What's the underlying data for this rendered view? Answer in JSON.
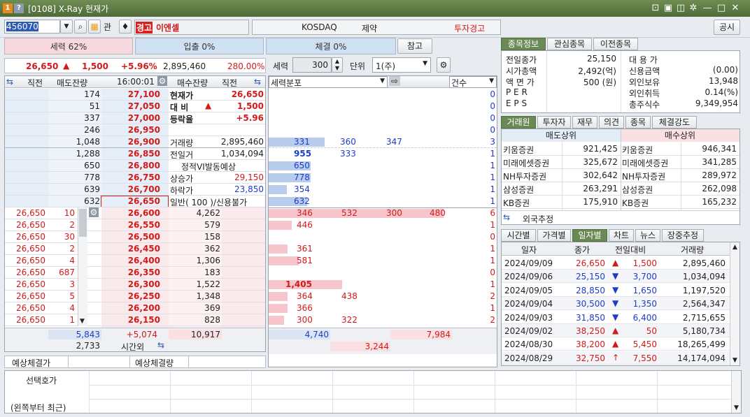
{
  "window": {
    "title": "[0108] X-Ray 현재가"
  },
  "toolbar": {
    "code": "456070",
    "stock_name": "이엔셀",
    "warn_badge": "경고",
    "market": "KOSDAQ",
    "sector": "제약",
    "warning": "투자경고",
    "notice_btn": "공시",
    "gwan": "관"
  },
  "row2": {
    "force": "세력 62%",
    "inout": "입출 0%",
    "fill": "체결 0%",
    "ref": "참고"
  },
  "price_row": {
    "price": "26,650",
    "arrow": "▲",
    "change": "1,500",
    "rate": "+5.96%",
    "volume": "2,895,460",
    "vol_rate": "280.00%",
    "force_label": "세력",
    "force_val": "300",
    "unit_label": "단위",
    "unit_val": "1(주)"
  },
  "ob_header": {
    "prev": "직전",
    "sell_qty": "매도잔량",
    "time": "16:00:01",
    "buy_qty": "매수잔량",
    "prev2": "직전"
  },
  "asks": [
    {
      "qty": "174",
      "price": "27,100"
    },
    {
      "qty": "51",
      "price": "27,050"
    },
    {
      "qty": "337",
      "price": "27,000"
    },
    {
      "qty": "246",
      "price": "26,950"
    },
    {
      "qty": "1,048",
      "price": "26,900"
    },
    {
      "qty": "1,288",
      "price": "26,850"
    },
    {
      "qty": "650",
      "price": "26,800"
    },
    {
      "qty": "778",
      "price": "26,750"
    },
    {
      "qty": "639",
      "price": "26,700"
    },
    {
      "qty": "632",
      "price": "26,650"
    }
  ],
  "bids": [
    {
      "price": "26,600",
      "qty": "4,262",
      "ep": "26,650",
      "ev": "10"
    },
    {
      "price": "26,550",
      "qty": "579",
      "ep": "26,650",
      "ev": "2"
    },
    {
      "price": "26,500",
      "qty": "158",
      "ep": "26,650",
      "ev": "30"
    },
    {
      "price": "26,450",
      "qty": "362",
      "ep": "26,650",
      "ev": "2"
    },
    {
      "price": "26,400",
      "qty": "1,306",
      "ep": "26,650",
      "ev": "4"
    },
    {
      "price": "26,350",
      "qty": "183",
      "ep": "26,650",
      "ev": "687"
    },
    {
      "price": "26,300",
      "qty": "1,522",
      "ep": "26,650",
      "ev": "3"
    },
    {
      "price": "26,250",
      "qty": "1,348",
      "ep": "26,650",
      "ev": "5"
    },
    {
      "price": "26,200",
      "qty": "369",
      "ep": "26,650",
      "ev": "4"
    },
    {
      "price": "26,150",
      "qty": "828",
      "ep": "26,650",
      "ev": "1"
    }
  ],
  "info": [
    {
      "k": "현재가",
      "v": "26,650"
    },
    {
      "k": "대 비",
      "v": "1,500",
      "a": "▲"
    },
    {
      "k": "등락율",
      "v": "+5.96"
    },
    {
      "k": "",
      "v": ""
    },
    {
      "k": "거래량",
      "v": "2,895,460"
    },
    {
      "k": "전일거",
      "v": "1,034,094"
    },
    {
      "k": "정적VI발동예상",
      "v": ""
    },
    {
      "k": "상승가",
      "v": "29,150"
    },
    {
      "k": "하락가",
      "v": "23,850"
    },
    {
      "k": "일반( 100 )/신용불가",
      "v": ""
    }
  ],
  "ob_total": {
    "sell": "5,843",
    "diff": "+5,074",
    "buy": "10,917",
    "after": "2,733",
    "after_label": "시간외"
  },
  "expect": {
    "l1": "예상체결가",
    "l2": "예상체결량"
  },
  "dist": {
    "header": "세력분포",
    "count_hdr": "건수",
    "rows": [
      {
        "a": "331",
        "b": "360",
        "c": "347",
        "n": "3",
        "w": 80
      },
      {
        "a": "955",
        "b": "333",
        "c": "",
        "n": "1",
        "w": 0
      },
      {
        "a": "650",
        "b": "",
        "c": "",
        "n": "1",
        "w": 60
      },
      {
        "a": "778",
        "b": "",
        "c": "",
        "n": "1",
        "w": 60
      },
      {
        "a": "354",
        "b": "",
        "c": "",
        "n": "1",
        "w": 26
      },
      {
        "a": "632",
        "b": "",
        "c": "",
        "n": "1",
        "w": 55
      }
    ],
    "bids": [
      {
        "a": "346",
        "b": "532",
        "c": "300",
        "d": "480",
        "n": "6",
        "w": 250
      },
      {
        "a": "446",
        "b": "",
        "c": "",
        "d": "",
        "n": "1",
        "w": 33
      },
      {
        "a": "",
        "b": "",
        "c": "",
        "d": "",
        "n": "0",
        "w": 0
      },
      {
        "a": "361",
        "b": "",
        "c": "",
        "d": "",
        "n": "1",
        "w": 27
      },
      {
        "a": "581",
        "b": "",
        "c": "",
        "d": "",
        "n": "1",
        "w": 43
      },
      {
        "a": "",
        "b": "",
        "c": "",
        "d": "",
        "n": "0",
        "w": 0
      },
      {
        "a": "1,405",
        "b": "",
        "c": "",
        "d": "",
        "n": "1",
        "w": 105
      },
      {
        "a": "364",
        "b": "438",
        "c": "",
        "d": "",
        "n": "2",
        "w": 27
      },
      {
        "a": "366",
        "b": "",
        "c": "",
        "d": "",
        "n": "1",
        "w": 27
      },
      {
        "a": "300",
        "b": "322",
        "c": "",
        "d": "",
        "n": "2",
        "w": 22
      }
    ],
    "total_a": "4,740",
    "total_b": "7,984",
    "total_c": "3,244"
  },
  "bottom": {
    "l1": "선택호가",
    "l2": "(왼쪽부터 최근)"
  },
  "right_tabs1": [
    "종목정보",
    "관심종목",
    "이전종목"
  ],
  "stock_info": [
    {
      "k": "전일종가",
      "v": "25,150",
      "k2": "대 용 가",
      "v2": ""
    },
    {
      "k": "시가총액",
      "v": "2,492(억)",
      "k2": "신용금액",
      "v2": "(0.00)"
    },
    {
      "k": "액 면 가",
      "v": "500 (원)",
      "k2": "외인보유",
      "v2": "13,948"
    },
    {
      "k": "P E R",
      "v": "",
      "k2": "외인취득",
      "v2": "0.14(%)"
    },
    {
      "k": "E P S",
      "v": "",
      "k2": "총주식수",
      "v2": "9,349,954"
    }
  ],
  "right_tabs2": [
    "거래원",
    "투자자",
    "재무",
    "의견",
    "종목",
    "체결강도"
  ],
  "broker_hdr": {
    "sell": "매도상위",
    "buy": "매수상위"
  },
  "brokers": [
    {
      "s": "키움증권",
      "sv": "921,425",
      "b": "키움증권",
      "bv": "946,341"
    },
    {
      "s": "미래에셋증권",
      "sv": "325,672",
      "b": "미래에셋증권",
      "bv": "341,285"
    },
    {
      "s": "NH투자증권",
      "sv": "302,642",
      "b": "NH투자증권",
      "bv": "289,972"
    },
    {
      "s": "삼성증권",
      "sv": "263,291",
      "b": "삼성증권",
      "bv": "262,098"
    },
    {
      "s": "KB증권",
      "sv": "175,910",
      "b": "KB증권",
      "bv": "165,232"
    }
  ],
  "foreign_est": "외국추정",
  "right_tabs3": [
    "시간별",
    "가격별",
    "일자별",
    "차트",
    "뉴스",
    "장중추정"
  ],
  "daily_hdr": {
    "date": "일자",
    "close": "종가",
    "diff": "전일대비",
    "vol": "거래량"
  },
  "daily": [
    {
      "d": "2024/09/09",
      "c": "26,650",
      "a": "▲",
      "df": "1,500",
      "v": "2,895,460",
      "col": "red"
    },
    {
      "d": "2024/09/06",
      "c": "25,150",
      "a": "▼",
      "df": "3,700",
      "v": "1,034,094",
      "col": "blue"
    },
    {
      "d": "2024/09/05",
      "c": "28,850",
      "a": "▼",
      "df": "1,650",
      "v": "1,197,520",
      "col": "blue"
    },
    {
      "d": "2024/09/04",
      "c": "30,500",
      "a": "▼",
      "df": "1,350",
      "v": "2,564,347",
      "col": "blue"
    },
    {
      "d": "2024/09/03",
      "c": "31,850",
      "a": "▼",
      "df": "6,400",
      "v": "2,715,655",
      "col": "blue"
    },
    {
      "d": "2024/09/02",
      "c": "38,250",
      "a": "▲",
      "df": "50",
      "v": "5,180,734",
      "col": "red"
    },
    {
      "d": "2024/08/30",
      "c": "38,200",
      "a": "▲",
      "df": "5,450",
      "v": "18,265,499",
      "col": "red"
    },
    {
      "d": "2024/08/29",
      "c": "32,750",
      "a": "↑",
      "df": "7,550",
      "v": "14,174,094",
      "col": "red"
    }
  ]
}
